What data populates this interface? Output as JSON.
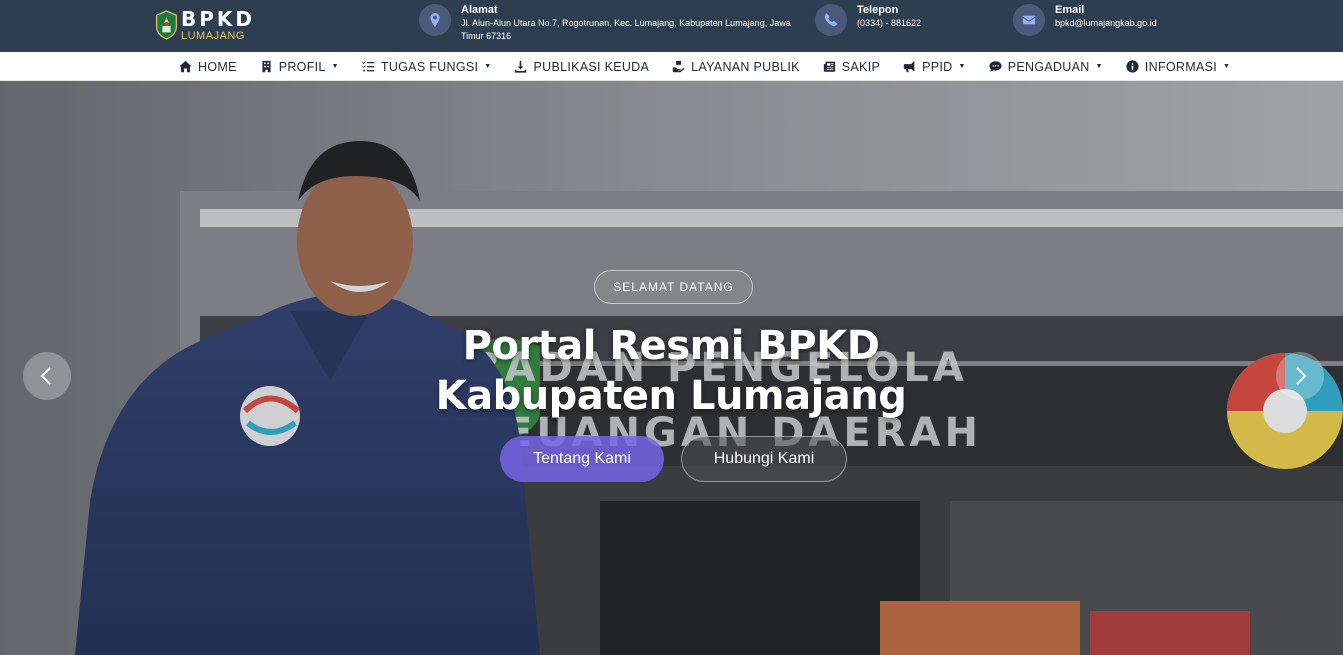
{
  "header": {
    "logo": {
      "main": "BPKD",
      "sub": "LUMAJANG"
    },
    "contacts": {
      "address": {
        "title": "Alamat",
        "value": "Jl. Alun-Alun Utara No.7, Rogotrunan, Kec. Lumajang, Kabupaten Lumajang, Jawa Timur 67316",
        "icon": "map-marker-icon"
      },
      "phone": {
        "title": "Telepon",
        "value": "(0334) - 881622",
        "icon": "phone-icon"
      },
      "email": {
        "title": "Email",
        "value": "bpkd@lumajangkab.go.id",
        "icon": "envelope-icon"
      }
    }
  },
  "nav": {
    "items": [
      {
        "label": "HOME",
        "icon": "home-icon",
        "dropdown": false
      },
      {
        "label": "PROFIL",
        "icon": "building-icon",
        "dropdown": true
      },
      {
        "label": "TUGAS FUNGSI",
        "icon": "list-icon",
        "dropdown": true
      },
      {
        "label": "PUBLIKASI KEUDA",
        "icon": "download-icon",
        "dropdown": false
      },
      {
        "label": "LAYANAN PUBLIK",
        "icon": "hand-holding-icon",
        "dropdown": false
      },
      {
        "label": "SAKIP",
        "icon": "newspaper-icon",
        "dropdown": false
      },
      {
        "label": "PPID",
        "icon": "bullhorn-icon",
        "dropdown": true
      },
      {
        "label": "PENGADUAN",
        "icon": "comment-icon",
        "dropdown": true
      },
      {
        "label": "INFORMASI",
        "icon": "info-circle-icon",
        "dropdown": true
      }
    ]
  },
  "hero": {
    "badge": "SELAMAT DATANG",
    "title_line1": "Portal Resmi BPKD",
    "title_line2": "Kabupaten Lumajang",
    "primary_button": "Tentang Kami",
    "secondary_button": "Hubungi Kami",
    "background_sign_text": "BADAN PENGELOLA KEUANGAN DAERAH"
  },
  "colors": {
    "topbar": "#2c3e50",
    "accent": "#7864e6",
    "icon_circle": "#4a5a78"
  }
}
